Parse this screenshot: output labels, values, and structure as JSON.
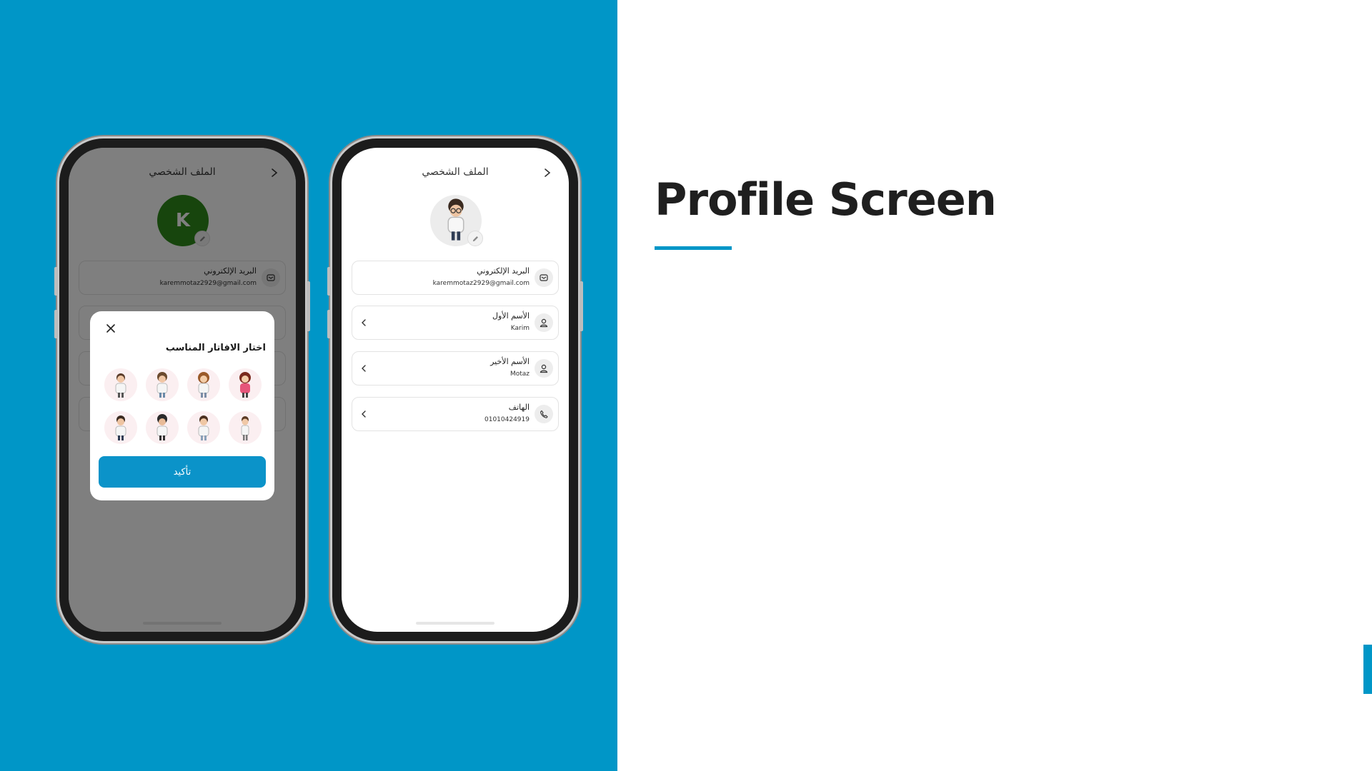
{
  "slide": {
    "heading": "Profile Screen",
    "accent_color": "#0096c7"
  },
  "profile": {
    "title": "الملف الشخصي",
    "avatar_letter": "K",
    "avatar_letter_bg": "#2e8b1a",
    "email_label": "البريد الإلكتروني",
    "email_value": "karemmotaz2929@gmail.com",
    "first_name_label": "الأسم الأول",
    "first_name_value": "Karim",
    "last_name_label": "الأسم الأخير",
    "last_name_value": "Motaz",
    "phone_label": "الهاتف",
    "phone_value": "01010424919"
  },
  "avatar_picker": {
    "title": "اختار الافاتار المناسب",
    "confirm_label": "تأكيد",
    "options": [
      "avatar-1",
      "avatar-2",
      "avatar-3",
      "avatar-4",
      "avatar-5",
      "avatar-6",
      "avatar-7",
      "avatar-8"
    ]
  },
  "icons": {
    "back": "chevron-right-icon",
    "close": "close-icon",
    "edit": "pencil-icon",
    "email": "envelope-icon",
    "person": "person-icon",
    "phone": "phone-icon",
    "field_arrow": "chevron-left-icon"
  }
}
